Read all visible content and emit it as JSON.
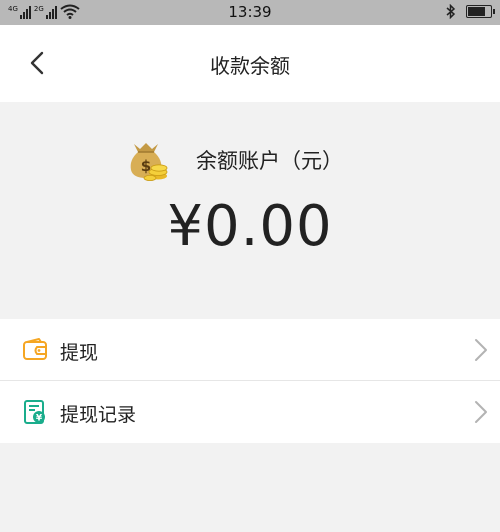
{
  "status_bar": {
    "net_tag_1": "4G",
    "net_tag_2": "2G",
    "time": "13:39",
    "icons": [
      "signal-icon",
      "signal-icon",
      "wifi-icon",
      "bluetooth-icon",
      "battery-icon"
    ]
  },
  "header": {
    "title": "收款余额",
    "back_icon": "chevron-left-icon"
  },
  "balance": {
    "icon": "money-bag-icon",
    "label": "余额账户（元）",
    "amount": "¥0.00"
  },
  "menu": {
    "items": [
      {
        "label": "提现",
        "icon": "wallet-icon",
        "icon_color": "#f5a623"
      },
      {
        "label": "提现记录",
        "icon": "record-icon",
        "icon_color": "#1aad8c"
      }
    ]
  },
  "colors": {
    "status_bar": "#b8b8b8",
    "background": "#f2f2f2",
    "card": "#ffffff",
    "text": "#222222"
  }
}
